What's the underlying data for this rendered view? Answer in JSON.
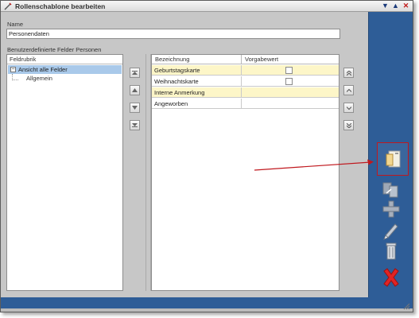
{
  "window": {
    "title": "Rollenschablone bearbeiten",
    "controls": [
      "pin-down-icon",
      "pin-up-icon",
      "close-icon"
    ]
  },
  "form": {
    "name_label": "Name",
    "name_value": "Personendaten",
    "fields_label": "Benutzerdefinierte Felder Personen"
  },
  "left_panel": {
    "header": "Feldrubrik",
    "tree": {
      "root": "Ansicht alle Felder",
      "children": [
        "Allgemein"
      ]
    }
  },
  "grid": {
    "columns": [
      "Bezeichnung",
      "Vorgabewert"
    ],
    "rows": [
      {
        "label": "Geburtstagskarte",
        "has_checkbox": true,
        "checked": false,
        "highlight": true
      },
      {
        "label": "Weihnachtskarte",
        "has_checkbox": true,
        "checked": false,
        "highlight": false
      },
      {
        "label": "Interne Anmerkung",
        "has_checkbox": false,
        "checked": false,
        "highlight": true
      },
      {
        "label": "Angeworben",
        "has_checkbox": false,
        "checked": false,
        "highlight": false
      }
    ]
  },
  "toolbar": {
    "tools": [
      "open-template-icon",
      "copy-template-icon",
      "add-icon",
      "edit-icon",
      "delete-icon",
      "cancel-icon"
    ]
  },
  "colors": {
    "sidebar_blue": "#2e5d97",
    "selection_blue": "#a9c9ea",
    "row_highlight": "#fdf6c8",
    "annotation_red": "#c0181e"
  }
}
